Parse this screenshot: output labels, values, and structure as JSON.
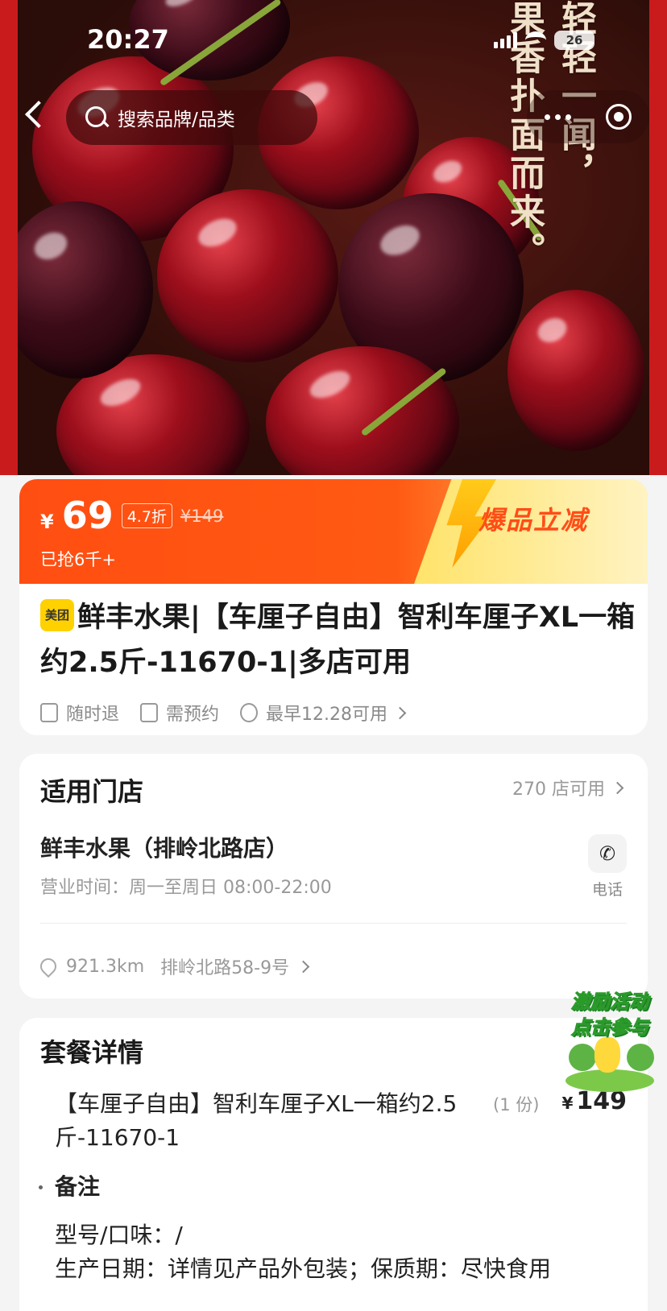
{
  "status_bar": {
    "time": "20:27",
    "battery": "26"
  },
  "hero": {
    "poem_col1": "轻轻一闻，",
    "poem_col2": "果香扑面而来。"
  },
  "search": {
    "placeholder": "搜索品牌/品类"
  },
  "price": {
    "currency": "¥",
    "current": "69",
    "discount": "4.7折",
    "original": "¥149",
    "sold": "已抢6千+",
    "promo": "爆品立减"
  },
  "product": {
    "brand_badge": "美团",
    "title": "鲜丰水果|【车厘子自由】智利车厘子XL一箱约2.5斤-11670-1|多店可用",
    "tags": [
      "随时退",
      "需预约",
      "最早12.28可用"
    ]
  },
  "stores": {
    "heading": "适用门店",
    "count": "270 店可用",
    "name": "鲜丰水果（排岭北路店）",
    "hours": "营业时间：周一至周日 08:00-22:00",
    "phone_label": "电话",
    "distance": "921.3km",
    "address": "排岭北路58-9号"
  },
  "package": {
    "heading": "套餐详情",
    "item_name": "【车厘子自由】智利车厘子XL一箱约2.5斤-11670-1",
    "item_qty": "(1 份)",
    "item_currency": "¥",
    "item_price": "149",
    "note_heading": "备注",
    "note_lines": [
      "型号/口味：/",
      "生产日期：详情见产品外包装；保质期：尽快食用"
    ]
  },
  "floating": {
    "line1": "激励活动",
    "line2": "点击参与"
  }
}
